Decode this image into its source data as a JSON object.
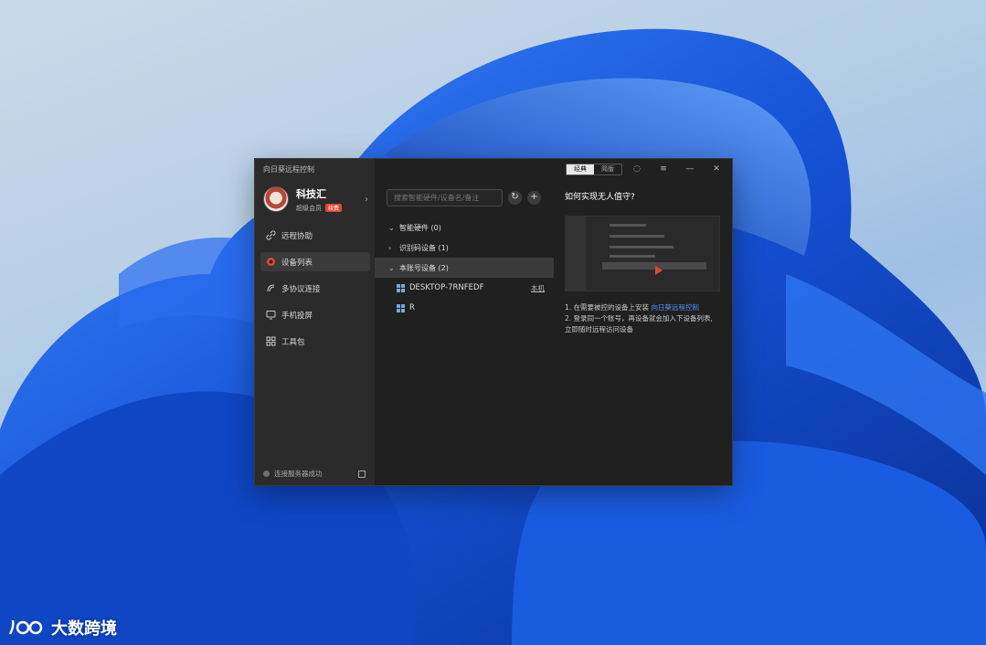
{
  "app": {
    "title": "向日葵远程控制",
    "mode_toggle": [
      "经典",
      "简版"
    ]
  },
  "profile": {
    "name": "科技汇",
    "subtitle": "超级会员",
    "badge": "续费"
  },
  "sidebar": {
    "items": [
      {
        "label": "远程协助",
        "icon": "link-icon"
      },
      {
        "label": "设备列表",
        "icon": "device-icon",
        "active": true
      },
      {
        "label": "多协议连接",
        "icon": "protocol-icon"
      },
      {
        "label": "手机投屏",
        "icon": "screen-cast-icon"
      },
      {
        "label": "工具包",
        "icon": "toolkit-icon"
      }
    ],
    "footer_status": "连接服务器成功"
  },
  "search": {
    "placeholder": "搜索智能硬件/设备名/备注"
  },
  "device_groups": [
    {
      "label": "智能硬件 (0)",
      "expanded": true
    },
    {
      "label": "识别码设备 (1)",
      "expanded": false
    },
    {
      "label": "本账号设备 (2)",
      "expanded": true,
      "active": true
    }
  ],
  "devices": [
    {
      "name": "DESKTOP-7RNFEDF",
      "tag": "本机"
    },
    {
      "name": "R",
      "tag": ""
    }
  ],
  "help": {
    "title": "如何实现无人值守?",
    "step1_prefix": "1. 在需要被控的设备上安装",
    "step1_link": "向日葵远程控制",
    "step2_line1": "2. 登录同一个账号，再设备就会加入下设备列表,",
    "step2_line2": "    立即随时远程访问设备"
  },
  "watermark": {
    "text": "大数跨境"
  },
  "colors": {
    "accent_red": "#e0463c",
    "link_blue": "#4f8ef5",
    "panel_bg": "#202020",
    "sidebar_bg": "#2b2b2b"
  }
}
